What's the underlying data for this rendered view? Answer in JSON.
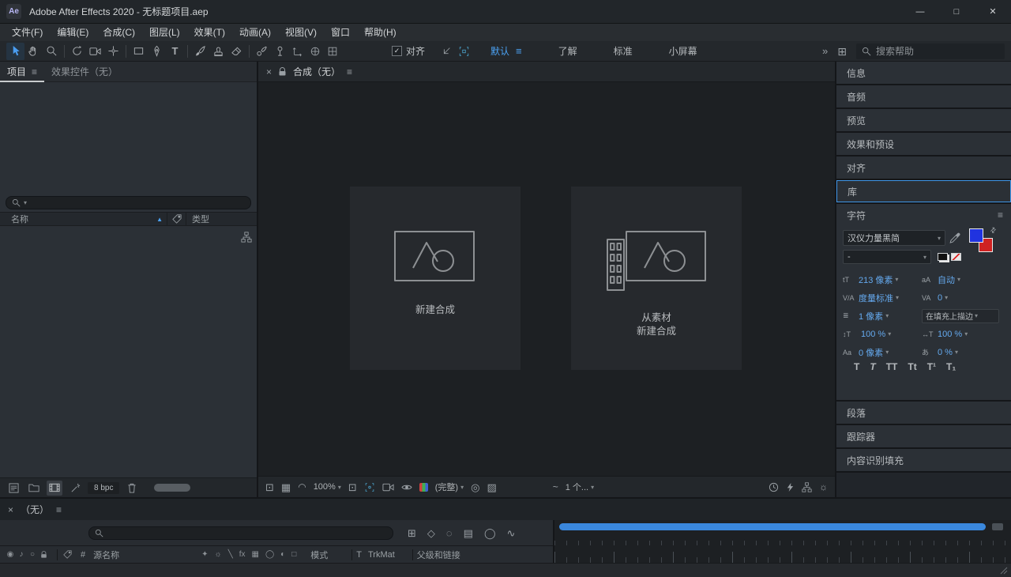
{
  "window": {
    "logo": "Ae",
    "title": "Adobe After Effects 2020 - 无标题项目.aep",
    "minimize": "—",
    "maximize": "□",
    "close": "✕"
  },
  "menubar": {
    "items": [
      "文件(F)",
      "编辑(E)",
      "合成(C)",
      "图层(L)",
      "效果(T)",
      "动画(A)",
      "视图(V)",
      "窗口",
      "帮助(H)"
    ]
  },
  "toolbar": {
    "snap_label": "对齐",
    "workspaces": [
      "默认",
      "了解",
      "标准",
      "小屏幕"
    ],
    "search_placeholder": "搜索帮助"
  },
  "project_panel": {
    "tab_project": "项目",
    "tab_effects": "效果控件（无）",
    "col_name": "名称",
    "col_type": "类型",
    "bit_depth": "8 bpc"
  },
  "comp_panel": {
    "tab": "合成（无）",
    "new_comp": "新建合成",
    "from_footage_1": "从素材",
    "from_footage_2": "新建合成",
    "zoom": "100%",
    "resolution": "(完整)",
    "views": "1 个...",
    "wave": "~"
  },
  "right_panel": {
    "rows_top": [
      "信息",
      "音频",
      "预览",
      "效果和预设",
      "对齐",
      "库"
    ],
    "character": {
      "title": "字符",
      "font_family": "汉仪力量黑简",
      "font_style": "-",
      "size": "213 像素",
      "leading": "自动",
      "kerning": "度量标准",
      "tracking": "0",
      "stroke_width": "1 像素",
      "stroke_mode": "在填充上描边",
      "vertical_scale": "100 %",
      "horizontal_scale": "100 %",
      "baseline_shift": "0 像素",
      "tsume": "0 %",
      "style_buttons": [
        "T",
        "T",
        "TT",
        "Tt",
        "T¹",
        "T₁"
      ]
    },
    "rows_bottom": [
      "段落",
      "跟踪器",
      "内容识别填充"
    ]
  },
  "timeline_panel": {
    "tab": "（无）",
    "col_hash": "#",
    "col_source_name": "源名称",
    "col_mode": "模式",
    "col_t": "T",
    "col_trkmat": "TrkMat",
    "col_parent": "父级和链接"
  },
  "icons": {
    "menu": "≡",
    "close": "×",
    "caret": "▾",
    "sort_asc": "▲",
    "overflow": "»",
    "check": "✓",
    "swap": "⇄",
    "grid": "▦",
    "monitor": "⊡",
    "mask": "◠",
    "roi": "⊡",
    "target": "◎",
    "checker": "▨",
    "panels": "⊞",
    "mini_flowchart": "⊞",
    "draft3d": "◇",
    "shy": "◌",
    "frame_blend": "▤",
    "motion_blur": "◯",
    "graph": "∿",
    "sun": "☼",
    "eye": "◉",
    "audio": "♪",
    "solo": "○",
    "sw_shy": "✦",
    "sw_collapse": "☼",
    "sw_quality": "╲",
    "sw_fx": "fx",
    "sw_blend": "▦",
    "sw_mblur": "◯",
    "sw_adjust": "◐",
    "sw_3d": "□",
    "ctl_size": "tT",
    "ctl_leading": "aA",
    "ctl_kerning": "V/A",
    "ctl_tracking": "VA",
    "ctl_stroke": "≣",
    "ctl_vscale": "↕T",
    "ctl_hscale": "↔T",
    "ctl_baseline": "Aa",
    "ctl_tsume": "あ"
  }
}
